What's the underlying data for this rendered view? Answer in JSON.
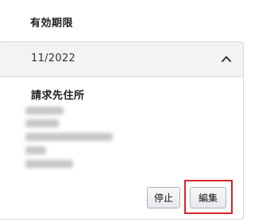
{
  "expiry": {
    "label": "有効期限",
    "value": "11/2022"
  },
  "billing": {
    "label": "請求先住所"
  },
  "actions": {
    "stop_label": "停止",
    "edit_label": "編集"
  },
  "icons": {
    "collapse": "chevron-up-icon"
  },
  "colors": {
    "highlight": "#d9232a",
    "header_bg": "#f3f3f3"
  }
}
